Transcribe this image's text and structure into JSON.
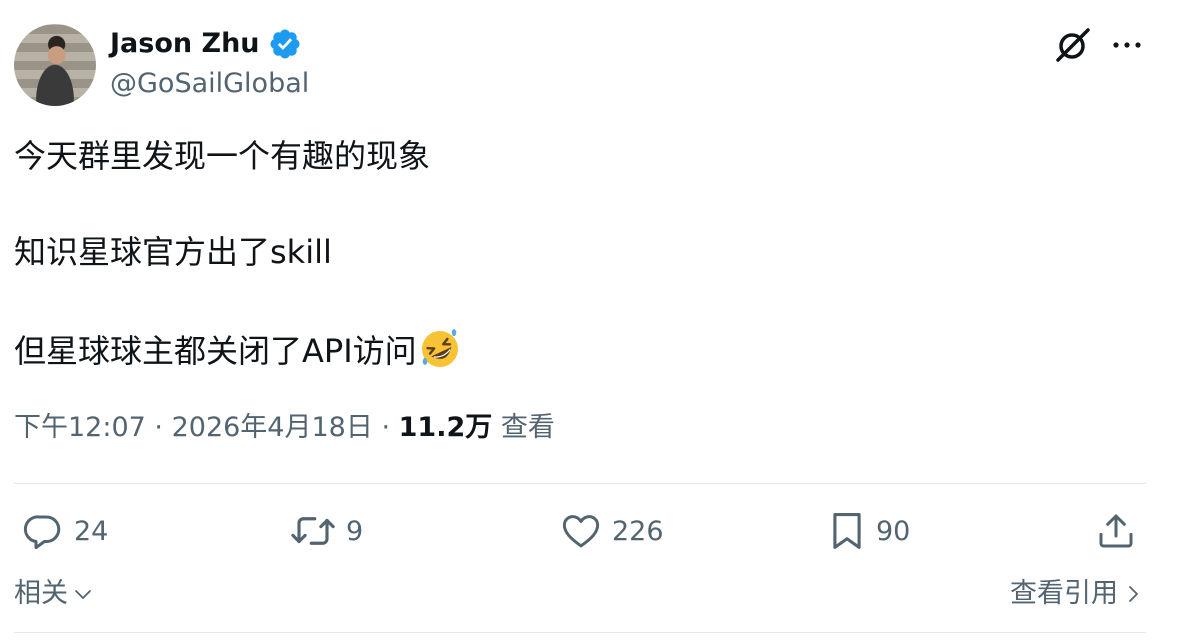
{
  "author": {
    "display_name": "Jason Zhu",
    "handle": "@GoSailGlobal",
    "verified_color": "#1d9bf0"
  },
  "header_icons": [
    "grok-icon",
    "more-icon"
  ],
  "tweet": {
    "lines": [
      "今天群里发现一个有趣的现象",
      "知识星球官方出了skill",
      "但星球球主都关闭了API访问"
    ],
    "emoji": "rolling-on-the-floor-laughing-icon"
  },
  "meta": {
    "time": "下午12:07",
    "separator": "·",
    "date": "2026年4月18日",
    "views_count": "11.2万",
    "views_label": "查看"
  },
  "actions": {
    "replies": "24",
    "reposts": "9",
    "likes": "226",
    "bookmarks": "90"
  },
  "footer": {
    "related_label": "相关",
    "quotes_label": "查看引用"
  },
  "colors": {
    "text": "#0f1419",
    "secondary": "#536471",
    "divider": "#e4e7ea"
  }
}
